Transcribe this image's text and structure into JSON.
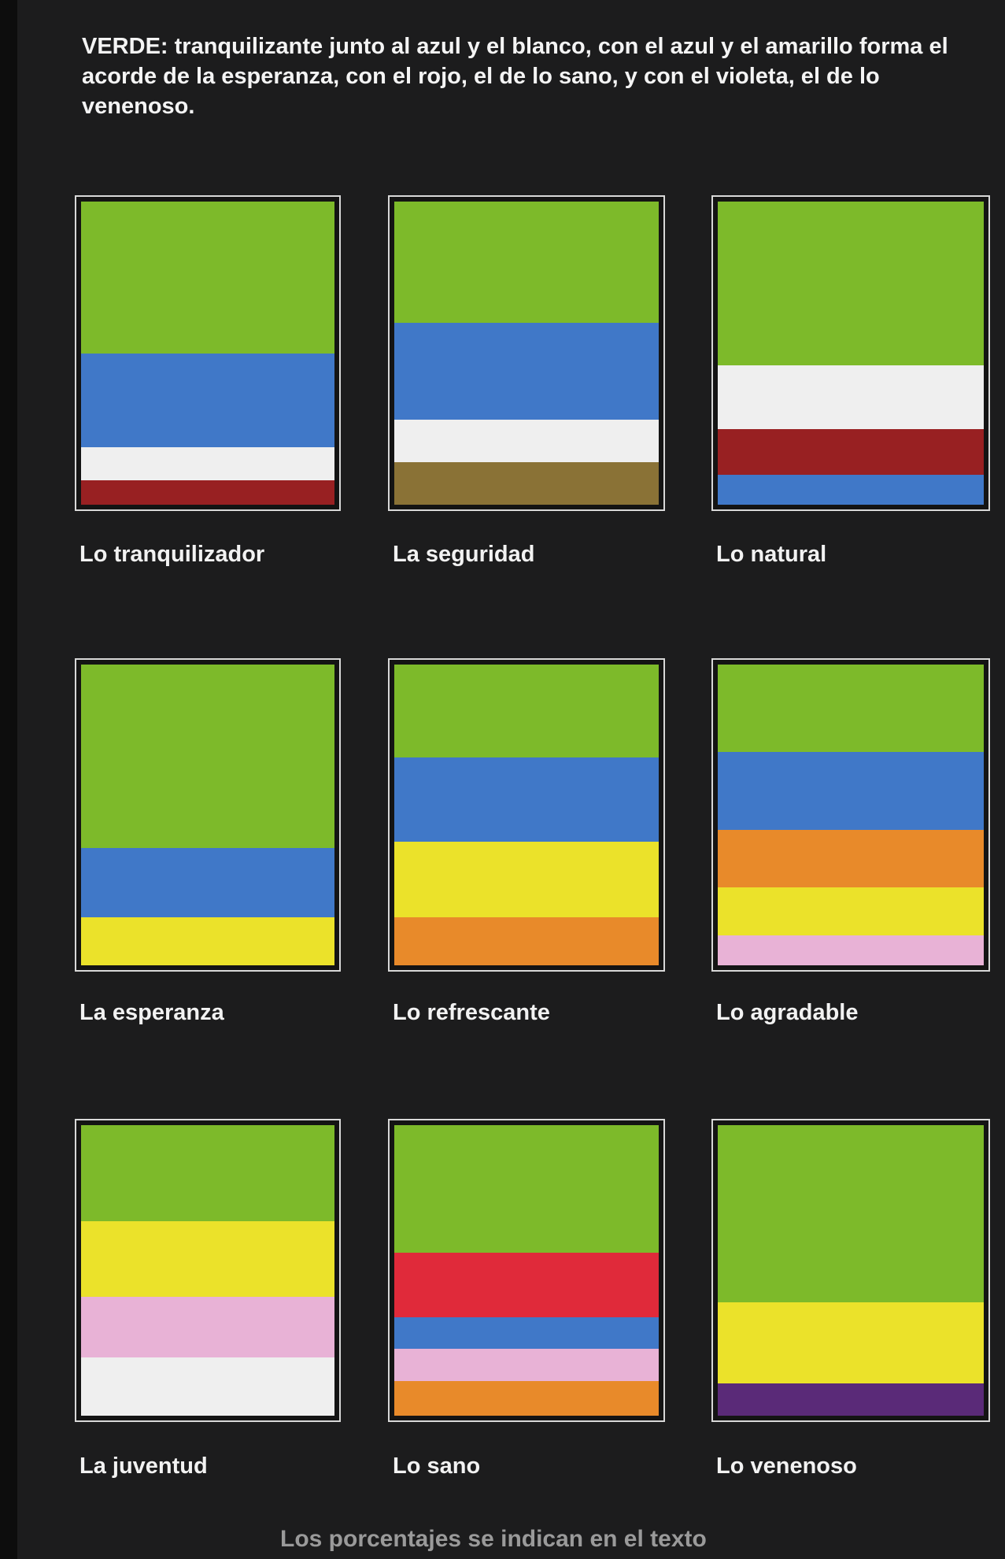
{
  "intro": "VERDE: tranquilizante junto al azul y el blanco, con el azul y el amarillo forma el acorde de la esperanza, con el rojo, el de lo sano, y con el violeta, el de lo venenoso.",
  "colors": {
    "green": "#7dba2a",
    "blue": "#4078c8",
    "white": "#efefef",
    "dark_red": "#982022",
    "brown": "#8a7236",
    "yellow": "#ebe22a",
    "orange": "#e88a2a",
    "pink": "#e8b2d6",
    "red": "#e02a3a",
    "violet": "#5a2a78"
  },
  "swatches": [
    {
      "label": "Lo tranquilizador",
      "stripes": [
        [
          "green",
          50
        ],
        [
          "blue",
          31
        ],
        [
          "white",
          11
        ],
        [
          "dark_red",
          8
        ]
      ]
    },
    {
      "label": "La seguridad",
      "stripes": [
        [
          "green",
          40
        ],
        [
          "blue",
          32
        ],
        [
          "white",
          14
        ],
        [
          "brown",
          14
        ]
      ]
    },
    {
      "label": "Lo natural",
      "stripes": [
        [
          "green",
          54
        ],
        [
          "white",
          21
        ],
        [
          "dark_red",
          15
        ],
        [
          "blue",
          10
        ]
      ]
    },
    {
      "label": "La esperanza",
      "stripes": [
        [
          "green",
          61
        ],
        [
          "blue",
          23
        ],
        [
          "yellow",
          16
        ]
      ]
    },
    {
      "label": "Lo refrescante",
      "stripes": [
        [
          "green",
          31
        ],
        [
          "blue",
          28
        ],
        [
          "yellow",
          25
        ],
        [
          "orange",
          16
        ]
      ]
    },
    {
      "label": "Lo agradable",
      "stripes": [
        [
          "green",
          29
        ],
        [
          "blue",
          26
        ],
        [
          "orange",
          19
        ],
        [
          "yellow",
          16
        ],
        [
          "pink",
          10
        ]
      ]
    },
    {
      "label": "La juventud",
      "stripes": [
        [
          "green",
          33
        ],
        [
          "yellow",
          26
        ],
        [
          "pink",
          21
        ],
        [
          "white",
          20
        ]
      ]
    },
    {
      "label": "Lo sano",
      "stripes": [
        [
          "green",
          44
        ],
        [
          "red",
          22
        ],
        [
          "blue",
          11
        ],
        [
          "pink",
          11
        ],
        [
          "orange",
          12
        ]
      ]
    },
    {
      "label": "Lo venenoso",
      "stripes": [
        [
          "green",
          61
        ],
        [
          "yellow",
          28
        ],
        [
          "violet",
          11
        ]
      ]
    }
  ],
  "footer": "Los porcentajes se indican en el texto"
}
